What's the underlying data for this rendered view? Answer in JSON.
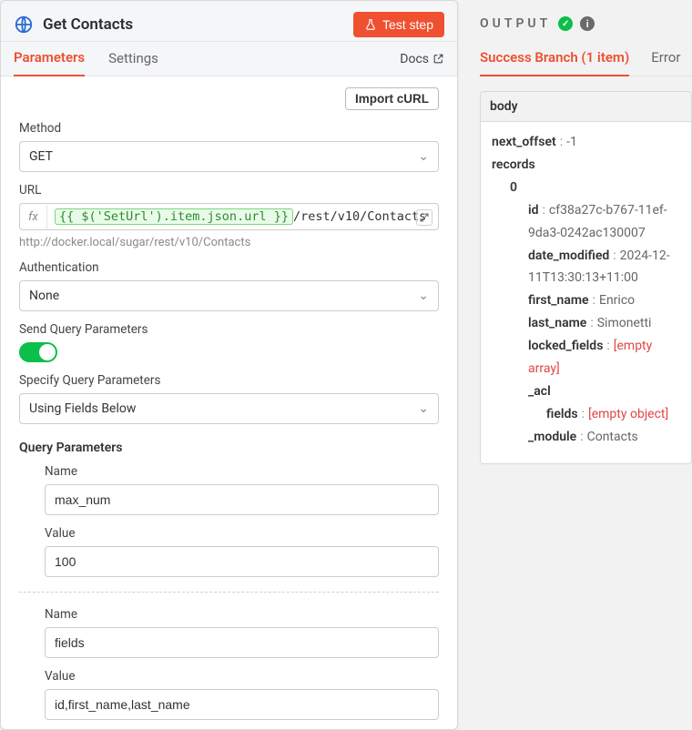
{
  "header": {
    "title": "Get Contacts",
    "test_label": "Test step"
  },
  "tabs": {
    "parameters": "Parameters",
    "settings": "Settings",
    "docs": "Docs"
  },
  "import_curl": "Import cURL",
  "method": {
    "label": "Method",
    "value": "GET"
  },
  "url": {
    "label": "URL",
    "expr": "{{ $('SetUrl').item.json.url }}",
    "suffix": "/rest/v10/Contacts",
    "resolved": "http://docker.local/sugar/rest/v10/Contacts"
  },
  "auth": {
    "label": "Authentication",
    "value": "None"
  },
  "sqp": {
    "label": "Send Query Parameters",
    "enabled": true
  },
  "specify": {
    "label": "Specify Query Parameters",
    "value": "Using Fields Below"
  },
  "qparams": {
    "head": "Query Parameters",
    "name_label": "Name",
    "value_label": "Value",
    "items": [
      {
        "name": "max_num",
        "value": "100"
      },
      {
        "name": "fields",
        "value": "id,first_name,last_name"
      }
    ]
  },
  "output": {
    "label": "OUTPUT",
    "success_tab": "Success Branch (1 item)",
    "error_tab": "Error",
    "body_label": "body",
    "record": {
      "next_offset_key": "next_offset",
      "next_offset": "-1",
      "records_key": "records",
      "index0": "0",
      "id_key": "id",
      "id": "cf38a27c-b767-11ef-9da3-0242ac130007",
      "date_modified_key": "date_modified",
      "date_modified": "2024-12-11T13:30:13+11:00",
      "first_name_key": "first_name",
      "first_name": "Enrico",
      "last_name_key": "last_name",
      "last_name": "Simonetti",
      "locked_fields_key": "locked_fields",
      "locked_fields": "[empty array]",
      "acl_key": "_acl",
      "fields_key": "fields",
      "fields_val": "[empty object]",
      "module_key": "_module",
      "module": "Contacts"
    }
  }
}
